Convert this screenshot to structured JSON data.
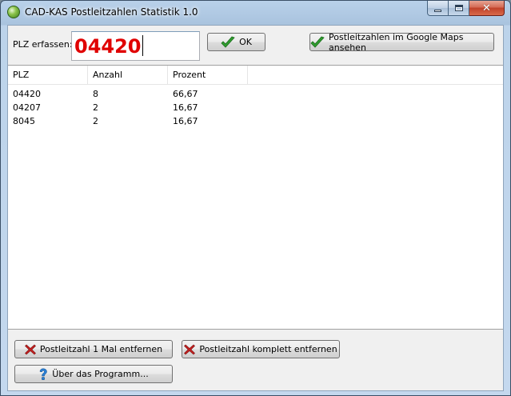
{
  "window": {
    "title": "CAD-KAS Postleitzahlen Statistik 1.0",
    "close_glyph": "✕"
  },
  "input": {
    "label": "PLZ erfassen:",
    "value": "04420",
    "value_color": "#e00000"
  },
  "buttons": {
    "ok": "OK",
    "maps": "Postleitzahlen im Google Maps ansehen",
    "remove_once": "Postleitzahl 1 Mal entfernen",
    "remove_all": "Postleitzahl komplett entfernen",
    "about": "Über das Programm..."
  },
  "table": {
    "columns": [
      "PLZ",
      "Anzahl",
      "Prozent"
    ],
    "rows": [
      [
        "04420",
        "8",
        "66,67"
      ],
      [
        "04207",
        "2",
        "16,67"
      ],
      [
        "8045",
        "2",
        "16,67"
      ]
    ]
  },
  "icons": {
    "ok": "green-checkmark-icon",
    "maps": "green-checkmark-icon",
    "remove": "red-x-icon",
    "about": "blue-question-icon"
  }
}
